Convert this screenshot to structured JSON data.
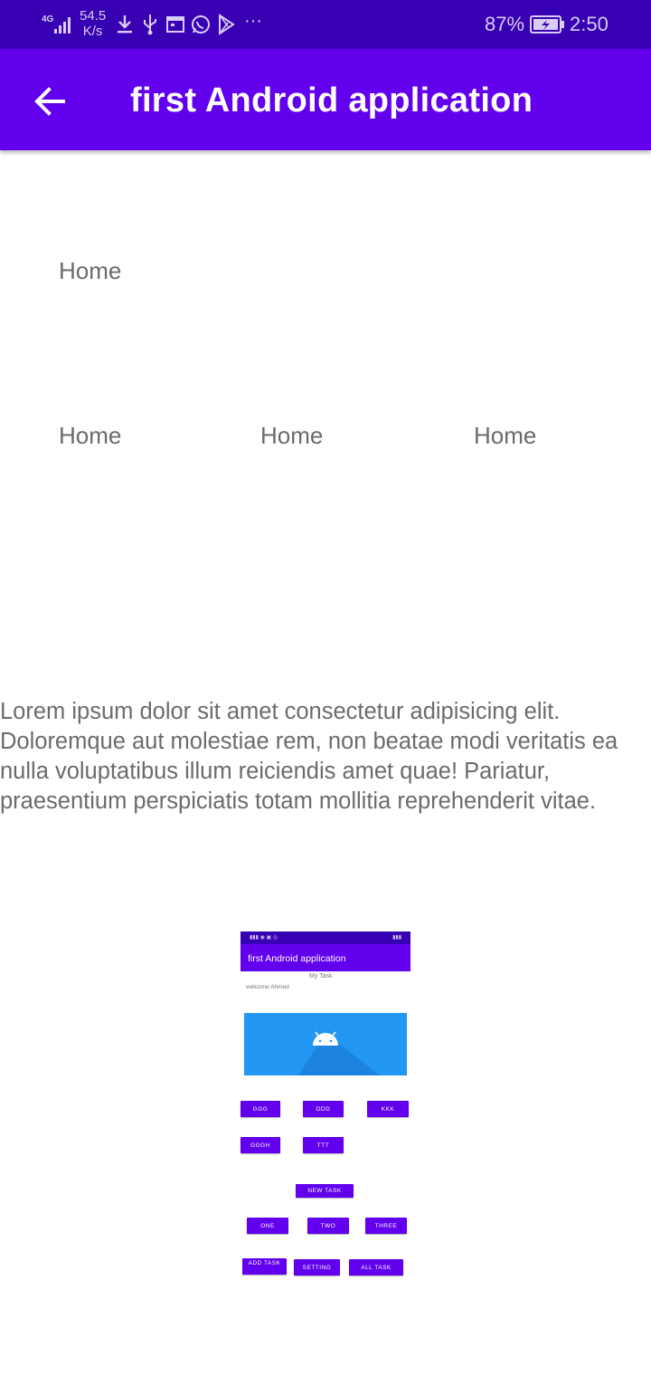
{
  "status_bar": {
    "network_type": "4G",
    "speed_value": "54.5",
    "speed_unit": "K/s",
    "more": "···",
    "battery_percent": "87%",
    "time": "2:50"
  },
  "app_bar": {
    "title": "first Android application",
    "back_icon": "arrow-back-icon"
  },
  "home_labels": [
    "Home",
    "Home",
    "Home",
    "Home"
  ],
  "paragraph": "Lorem ipsum dolor sit amet consectetur adipisicing elit. Doloremque aut molestiae rem, non beatae modi veritatis ea nulla voluptatibus illum reiciendis amet quae! Pariatur, praesentium perspiciatis totam mollitia reprehenderit vitae.",
  "preview": {
    "app_title": "first Android application",
    "my_task": "My Task",
    "welcome": "welcome Ahmed",
    "buttons_row1": [
      "GGG",
      "DDD",
      "KKK"
    ],
    "buttons_row2": [
      "GGGH",
      "TTT"
    ],
    "new_task": "NEW TASK",
    "buttons_row3": [
      "ONE",
      "TWO",
      "THREE"
    ],
    "buttons_row4": [
      "ADD TASK",
      "SETTING",
      "ALL TASK"
    ]
  },
  "colors": {
    "status_bar": "#3700B3",
    "primary": "#6200EE",
    "banner": "#2196F3",
    "text_gray": "#6b6b6b"
  }
}
